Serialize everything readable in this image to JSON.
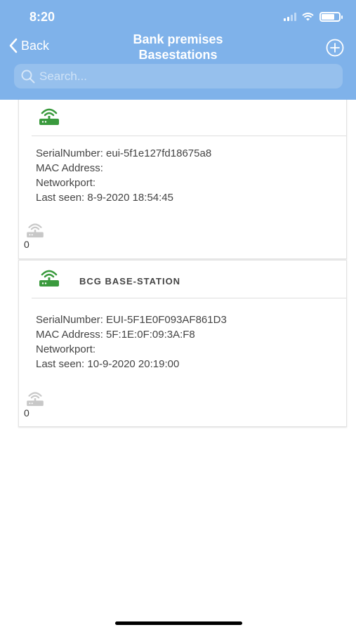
{
  "status_bar": {
    "time": "8:20",
    "battery_level": 0.75
  },
  "nav": {
    "back_label": "Back",
    "title_line1": "Bank premises",
    "title_line2": "Basestations",
    "add_icon": "plus-circle-icon"
  },
  "search": {
    "placeholder": "Search..."
  },
  "colors": {
    "header": "#7fb2ea",
    "router_active": "#3a9a3d",
    "router_inactive": "#c8c8c8"
  },
  "basestations": [
    {
      "name": "",
      "serial_line": "SerialNumber: eui-5f1e127fd18675a8",
      "mac_line": "MAC Address:",
      "networkport_line": "Networkport:",
      "last_seen_line": "Last seen: 8-9-2020 18:54:45",
      "device_count": "0"
    },
    {
      "name": "BCG BASE-STATION",
      "serial_line": "SerialNumber: EUI-5F1E0F093AF861D3",
      "mac_line": "MAC Address: 5F:1E:0F:09:3A:F8",
      "networkport_line": "Networkport:",
      "last_seen_line": "Last seen: 10-9-2020 20:19:00",
      "device_count": "0"
    }
  ]
}
